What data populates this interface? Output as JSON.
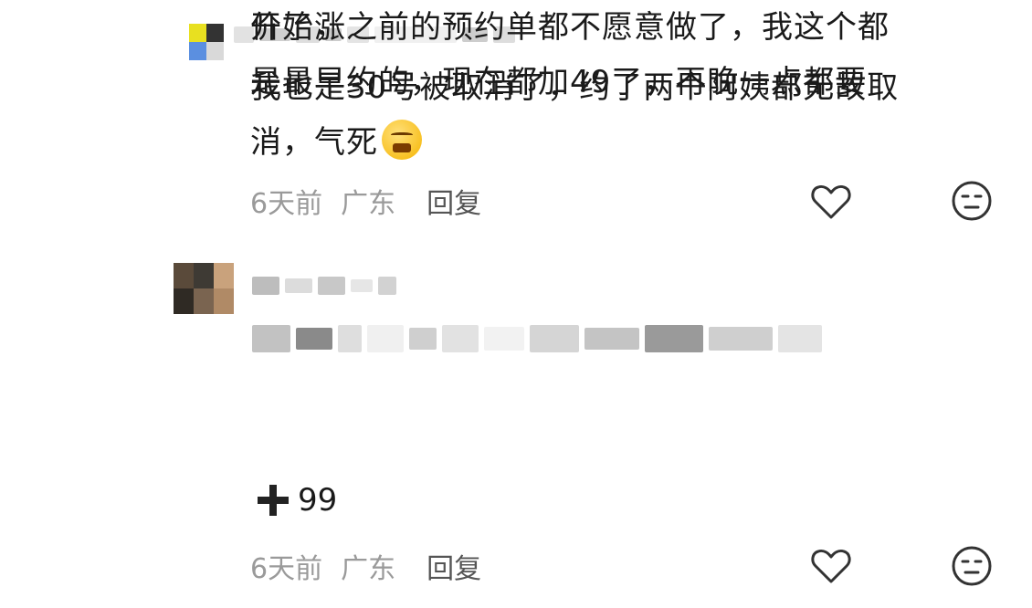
{
  "comments": [
    {
      "text_lines": [
        "我也是30号被取消了，约了两个阿姨都无故取",
        "消，气死"
      ],
      "emoji": "angry-face-icon",
      "time": "6天前",
      "location": "广东",
      "reply_label": "回复",
      "like_icon": "heart-outline-icon",
      "dislike_icon": "unamused-face-icon"
    },
    {
      "text_tail": "开始涨",
      "text_lines": [
        "价了，之前的预约单都不愿意做了，我这个都",
        "是最早约的，现在都加49了，再晚一点都要"
      ],
      "plus_value": "99",
      "time": "6天前",
      "location": "广东",
      "reply_label": "回复",
      "like_icon": "heart-outline-icon",
      "dislike_icon": "unamused-face-icon"
    }
  ],
  "colors": {
    "text": "#1a1a1a",
    "meta": "#9a9a9a",
    "reply": "#555555",
    "icon": "#333333"
  }
}
